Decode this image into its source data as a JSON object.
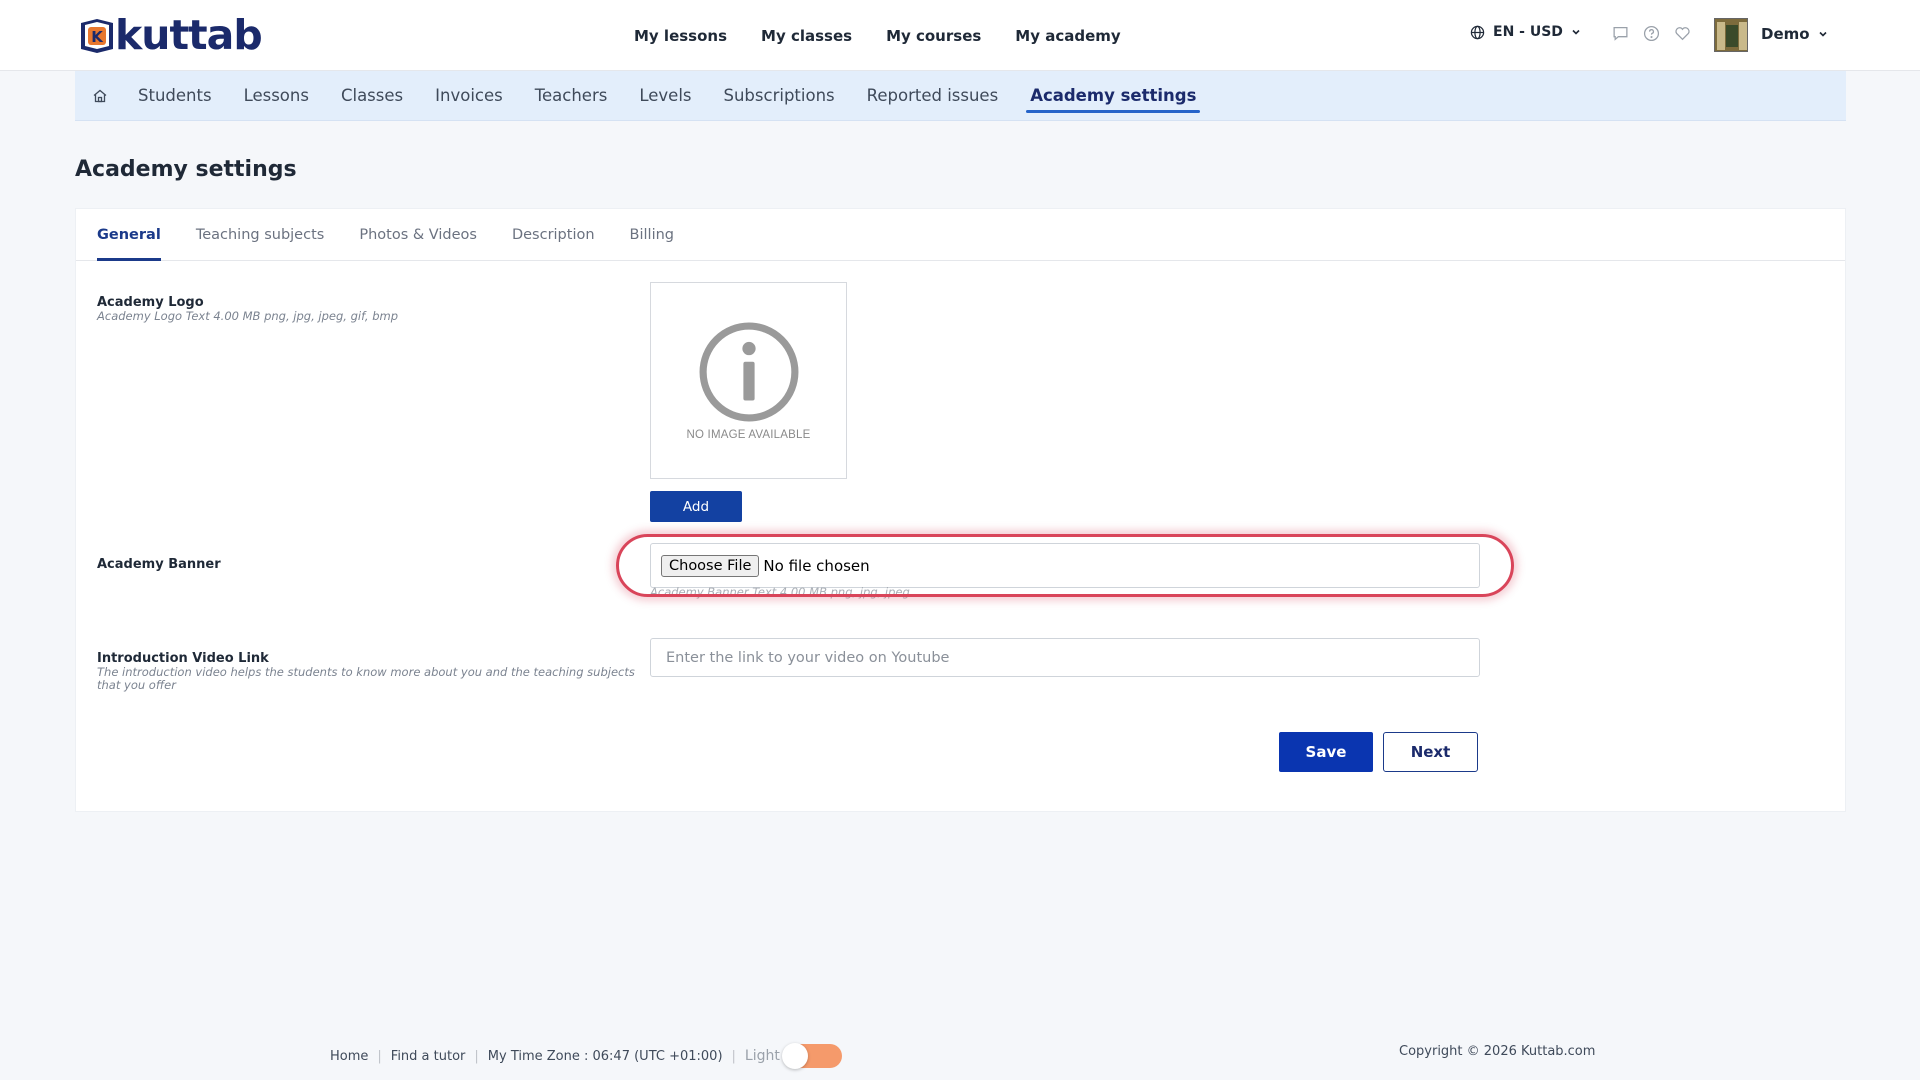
{
  "brand": {
    "name": "kuttab"
  },
  "main_nav": [
    "My lessons",
    "My classes",
    "My courses",
    "My academy"
  ],
  "header": {
    "language_currency": "EN - USD",
    "user_name": "Demo"
  },
  "icons": {
    "globe": "globe-icon",
    "chat": "chat-icon",
    "help": "help-icon",
    "heart": "heart-icon",
    "chevron": "chevron-down-icon",
    "home": "home-icon"
  },
  "sub_nav": {
    "items": [
      "Students",
      "Lessons",
      "Classes",
      "Invoices",
      "Teachers",
      "Levels",
      "Subscriptions",
      "Reported issues",
      "Academy settings"
    ],
    "active": "Academy settings"
  },
  "page": {
    "title": "Academy settings"
  },
  "tabs": {
    "items": [
      "General",
      "Teaching subjects",
      "Photos & Videos",
      "Description",
      "Billing"
    ],
    "active": "General"
  },
  "form": {
    "logo": {
      "label": "Academy Logo",
      "hint": "Academy Logo Text 4.00 MB png, jpg, jpeg, gif, bmp",
      "placeholder_text": "NO IMAGE AVAILABLE",
      "add_button": "Add"
    },
    "banner": {
      "label": "Academy Banner",
      "choose_button": "Choose File",
      "file_status": "No file chosen",
      "hint": "Academy Banner Text 4.00 MB png, jpg, jpeg"
    },
    "video": {
      "label": "Introduction Video Link",
      "hint": "The introduction video helps the students to know more about you and the teaching subjects that you offer",
      "placeholder": "Enter the link to your video on Youtube",
      "value": ""
    },
    "save_button": "Save",
    "next_button": "Next"
  },
  "footer": {
    "home": "Home",
    "find_tutor": "Find a tutor",
    "timezone": "My Time Zone : 06:47 (UTC +01:00)",
    "theme_label": "Light",
    "copyright": "Copyright © 2026 Kuttab.com"
  },
  "colors": {
    "primary": "#0a35b0",
    "brand_navy": "#1b2a6b",
    "subnav_bg": "#e3eefb",
    "highlight": "#d9455a",
    "toggle": "#f59a6b"
  }
}
